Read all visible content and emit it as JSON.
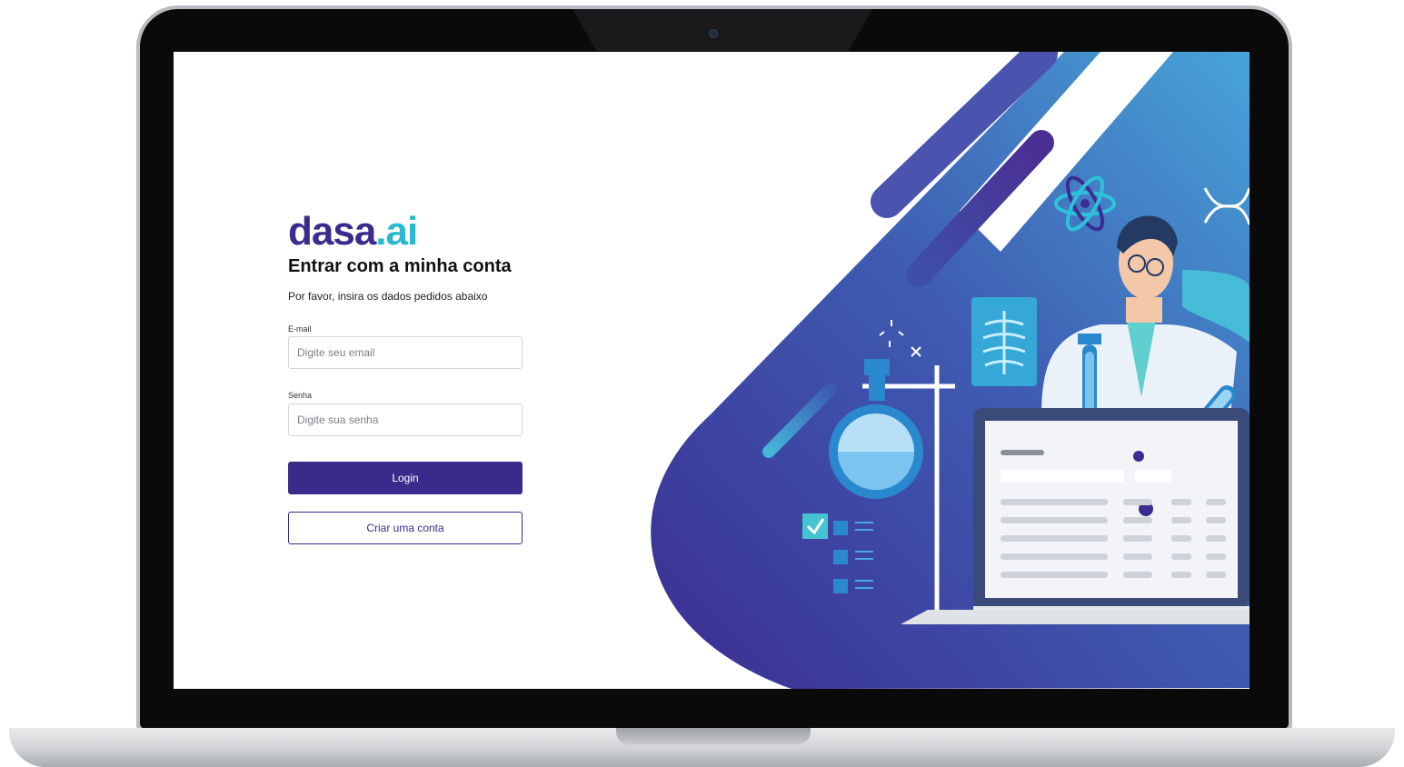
{
  "brand": {
    "logo_main": "dasa",
    "logo_suffix": ".ai",
    "colors": {
      "primary": "#3a2a8c",
      "accent": "#28b8cf"
    }
  },
  "login": {
    "title": "Entrar com a minha conta",
    "subtitle": "Por favor, insira os dados pedidos abaixo",
    "email": {
      "label": "E-mail",
      "placeholder": "Digite seu email",
      "value": ""
    },
    "password": {
      "label": "Senha",
      "placeholder": "Digite sua senha",
      "value": ""
    },
    "login_button": "Login",
    "create_account_button": "Criar uma conta"
  },
  "illustration": {
    "icons": [
      "atom-icon",
      "dna-icon",
      "xray-icon",
      "flask-icon",
      "test-tube-icon",
      "checklist-icon",
      "sparkle-icon"
    ]
  }
}
